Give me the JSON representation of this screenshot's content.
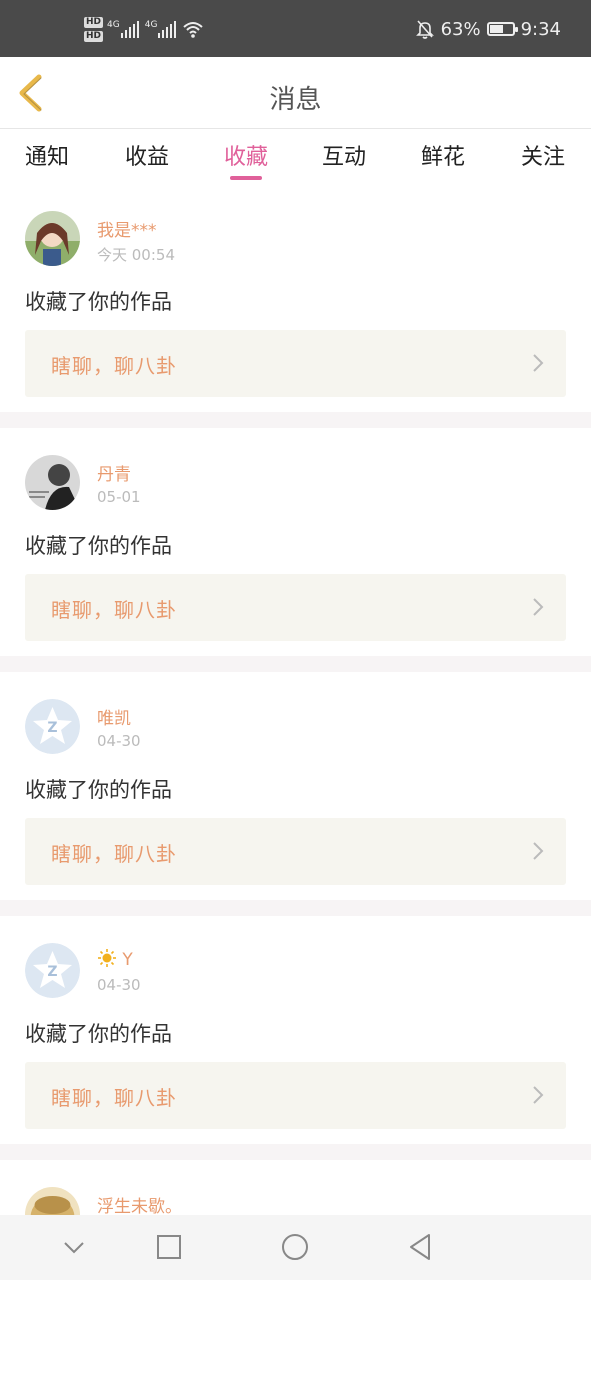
{
  "status_bar": {
    "hd1": "HD",
    "hd2": "HD",
    "net1": "4G",
    "net2": "4G",
    "battery_level": 0.63,
    "battery_text": "63%",
    "time": "9:34",
    "icons": [
      "signal-icon",
      "wifi-icon",
      "bell-off-icon",
      "battery-icon"
    ]
  },
  "header": {
    "title": "消息",
    "back_icon": "chevron-left-icon",
    "accent_color": "#e8b84a"
  },
  "tabs": [
    {
      "label": "通知",
      "active": false
    },
    {
      "label": "收益",
      "active": false
    },
    {
      "label": "收藏",
      "active": true
    },
    {
      "label": "互动",
      "active": false
    },
    {
      "label": "鲜花",
      "active": false
    },
    {
      "label": "关注",
      "active": false
    }
  ],
  "colors": {
    "active_tab": "#e0609a",
    "username": "#e89a6e",
    "work_bg": "#f6f5ef"
  },
  "items": [
    {
      "user": "我是***",
      "time": "今天 00:54",
      "action": "收藏了你的作品",
      "work": "瞎聊，聊八卦",
      "avatar": "anime-girl-avatar"
    },
    {
      "user": "丹青",
      "time": "05-01",
      "action": "收藏了你的作品",
      "work": "瞎聊，聊八卦",
      "avatar": "bw-photo-avatar"
    },
    {
      "user": "唯凯",
      "time": "04-30",
      "action": "收藏了你的作品",
      "work": "瞎聊，聊八卦",
      "avatar": "default-star-avatar"
    },
    {
      "user": "Y",
      "time": "04-30",
      "action": "收藏了你的作品",
      "work": "瞎聊，聊八卦",
      "avatar": "default-star-avatar"
    },
    {
      "user": "浮生未歇。",
      "time": "",
      "action": "",
      "work": "",
      "avatar": "cartoon-avatar"
    }
  ],
  "nav": [
    "chevron-down-icon",
    "square-icon",
    "circle-icon",
    "triangle-back-icon"
  ]
}
